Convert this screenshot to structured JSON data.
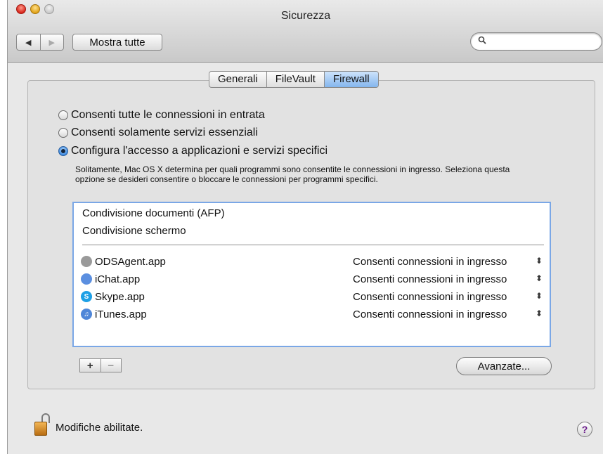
{
  "window": {
    "title": "Sicurezza"
  },
  "toolbar": {
    "back_icon": "back-arrow-icon",
    "forward_icon": "forward-arrow-icon",
    "back_glyph": "◀",
    "forward_glyph": "▶",
    "show_all_label": "Mostra tutte",
    "search_placeholder": "",
    "search_icon": "magnifier-icon"
  },
  "tabs": [
    {
      "label": "Generali",
      "active": false
    },
    {
      "label": "FileVault",
      "active": false
    },
    {
      "label": "Firewall",
      "active": true
    }
  ],
  "firewall": {
    "options": [
      {
        "label": "Consenti tutte le connessioni in entrata",
        "selected": false
      },
      {
        "label": "Consenti solamente servizi essenziali",
        "selected": false
      },
      {
        "label": "Configura l'accesso a applicazioni e servizi specifici",
        "selected": true
      }
    ],
    "description": "Solitamente, Mac OS X determina per quali programmi sono consentite le connessioni in ingresso. Seleziona questa opzione se desideri consentire o bloccare le connessioni per programmi specifici.",
    "services": [
      "Condivisione documenti (AFP)",
      "Condivisione schermo"
    ],
    "apps": [
      {
        "name": "ODSAgent.app",
        "setting": "Consenti connessioni in ingresso",
        "icon": "odsagent-icon",
        "color": "#9a9a9a",
        "glyph": ""
      },
      {
        "name": "iChat.app",
        "setting": "Consenti connessioni in ingresso",
        "icon": "ichat-icon",
        "color": "#5b8fe0",
        "glyph": ""
      },
      {
        "name": "Skype.app",
        "setting": "Consenti connessioni in ingresso",
        "icon": "skype-icon",
        "color": "#1ea0e6",
        "glyph": "S"
      },
      {
        "name": "iTunes.app",
        "setting": "Consenti connessioni in ingresso",
        "icon": "itunes-icon",
        "color": "#4f86d8",
        "glyph": "♫"
      }
    ],
    "popup_arrows": "⬍",
    "add_label": "+",
    "remove_label": "−",
    "advanced_label": "Avanzate..."
  },
  "footer": {
    "lock_label": "Modifiche abilitate.",
    "help_label": "?"
  }
}
